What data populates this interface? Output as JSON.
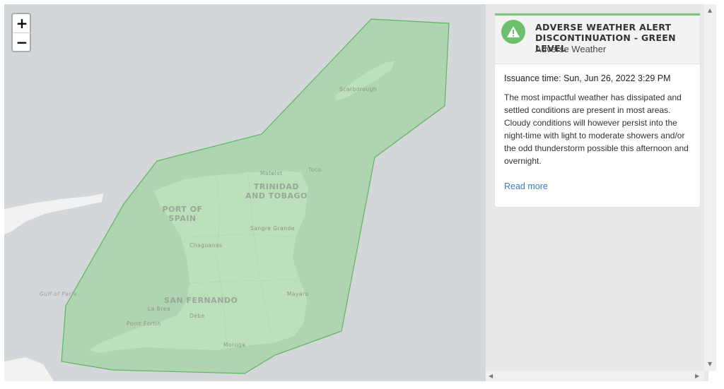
{
  "map": {
    "zoom_in_label": "+",
    "zoom_out_label": "−",
    "labels": {
      "country": "TRINIDAD AND TOBAGO",
      "port_of_spain": "PORT OF SPAIN",
      "san_fernando": "SAN FERNANDO",
      "scarborough": "Scarborough",
      "chaguanas": "Chaguanas",
      "sangre_grande": "Sangre Grande",
      "mayaro": "Mayaro",
      "matelot": "Matelot",
      "toco": "Toco",
      "la_brea": "La Brea",
      "debe": "Debe",
      "point_fortin": "Point Fortin",
      "moruga": "Moruga",
      "gulf_of_paria": "Gulf of Paria"
    },
    "colors": {
      "sea": "#d3d7da",
      "land": "#f2f2f0",
      "alert_fill": "#8fd18f",
      "alert_stroke": "#5cb85c"
    }
  },
  "alert": {
    "level_color": "#6cbf6c",
    "icon": "warning-triangle-icon",
    "title": "ADVERSE WEATHER ALERT DISCONTINUATION - GREEN LEVEL",
    "category": "Adverse Weather",
    "issuance": "Issuance time: Sun, Jun 26, 2022 3:29 PM",
    "description": "The most impactful weather has dissipated and settled conditions are present in most areas. Cloudy conditions will however persist into the night-time with light to moderate showers and/or the odd thunderstorm possible this afternoon and overnight.",
    "read_more": "Read more"
  }
}
